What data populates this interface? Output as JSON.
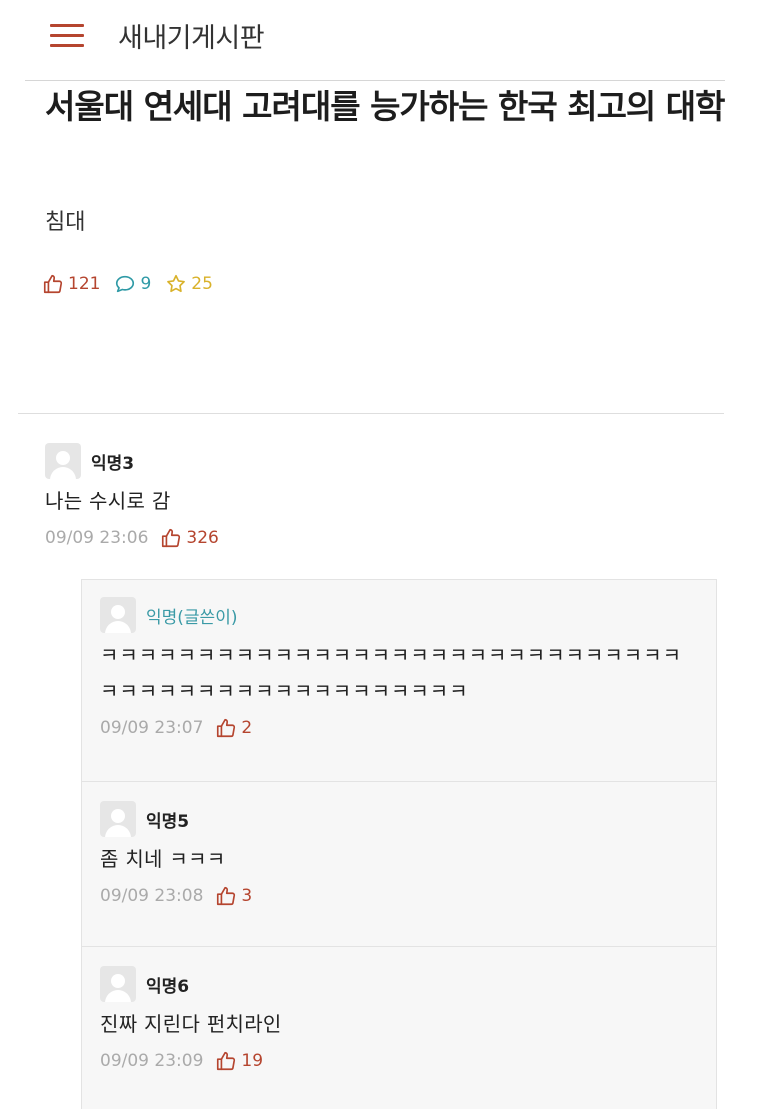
{
  "header": {
    "board_title": "새내기게시판"
  },
  "post": {
    "title": "서울대 연세대 고려대를 능가하는 한국 최고의 대학",
    "body": "침대",
    "likes": "121",
    "comments": "9",
    "scraps": "25"
  },
  "comments": [
    {
      "author": "익명3",
      "text": "나는 수시로 감",
      "time": "09/09 23:06",
      "likes": "326",
      "replies": [
        {
          "author": "익명(글쓴이)",
          "text": "ㅋㅋㅋㅋㅋㅋㅋㅋㅋㅋㅋㅋㅋㅋㅋㅋㅋㅋㅋㅋㅋㅋㅋㅋㅋㅋㅋㅋㅋㅋㅋㅋㅋㅋㅋㅋㅋㅋㅋㅋㅋㅋㅋㅋㅋㅋㅋㅋㅋ",
          "time": "09/09 23:07",
          "likes": "2"
        },
        {
          "author": "익명5",
          "text": "좀 치네 ㅋㅋㅋ",
          "time": "09/09 23:08",
          "likes": "3"
        },
        {
          "author": "익명6",
          "text": "진짜 지린다 펀치라인",
          "time": "09/09 23:09",
          "likes": "19"
        }
      ]
    }
  ],
  "colors": {
    "accent_red": "#b5452f",
    "comment_teal": "#2f9aa6",
    "scrap_yellow": "#d9b22a",
    "meta_gray": "#aaaaaa",
    "reply_bg": "#f7f7f7"
  },
  "icons": {
    "menu": "hamburger-icon",
    "like": "thumbs-up-icon",
    "comment": "speech-bubble-icon",
    "scrap": "star-icon",
    "avatar": "default-avatar-icon"
  }
}
